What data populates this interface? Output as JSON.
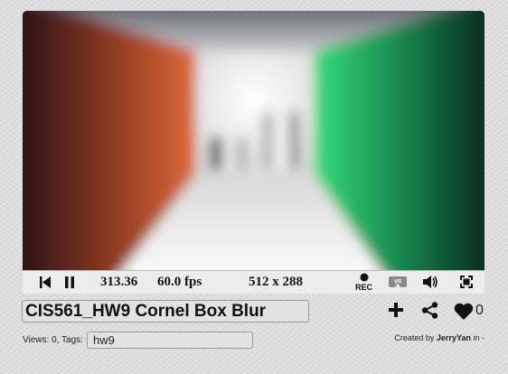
{
  "shader": {
    "title": "CIS561_HW9 Cornel Box Blur",
    "views_label": "Views:",
    "views_count": "0",
    "tags_label": "Tags:",
    "tags_value": "hw9",
    "created_by_label": "Created by",
    "author": "JerryYan",
    "in_label": "in",
    "category": "-",
    "likes": "0"
  },
  "player": {
    "time": "313.36",
    "fps": "60.0 fps",
    "resolution": "512 x 288",
    "rec_label": "REC",
    "vr_label": "VR"
  },
  "icons": {
    "rewind": "rewind-icon",
    "pause": "pause-icon",
    "record": "record-icon",
    "vr": "vr-icon",
    "volume": "volume-icon",
    "fullscreen": "fullscreen-icon",
    "add": "plus-icon",
    "share": "share-icon",
    "like": "heart-icon"
  },
  "colors": {
    "left_wall": "#d8663a",
    "right_wall": "#2fd476",
    "back_wall": "#f2f2f2",
    "floor": "#e6e6e6",
    "ceiling": "#8a8a94"
  }
}
